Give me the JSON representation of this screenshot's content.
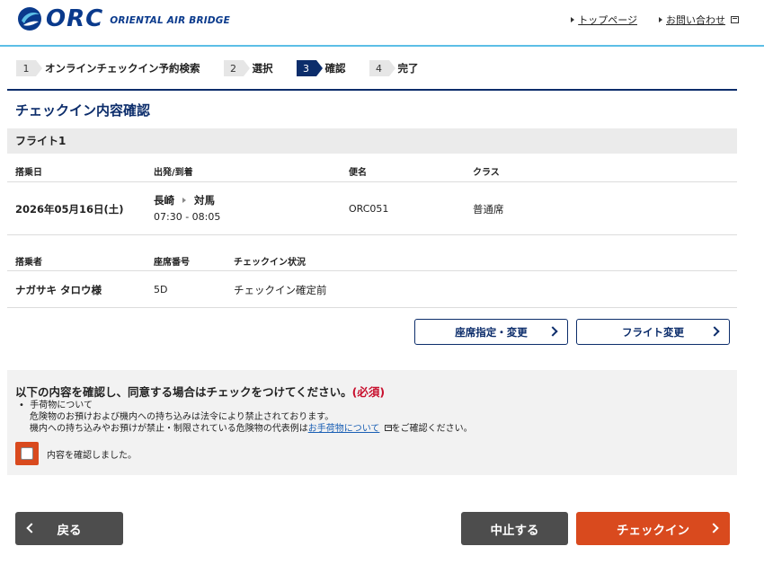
{
  "header": {
    "brand": "ORC",
    "brand_sub": "ORIENTAL AIR BRIDGE",
    "links": [
      "トップページ",
      "お問い合わせ"
    ]
  },
  "steps": [
    {
      "num": "1",
      "label": "オンラインチェックイン予約検索"
    },
    {
      "num": "2",
      "label": "選択"
    },
    {
      "num": "3",
      "label": "確認",
      "active": true
    },
    {
      "num": "4",
      "label": "完了"
    }
  ],
  "page_title": "チェックイン内容確認",
  "flight": {
    "heading": "フライト1",
    "headers": {
      "date": "搭乗日",
      "route": "出発/到着",
      "flight_no": "便名",
      "class": "クラス"
    },
    "date": "2026年05月16日(土)",
    "from": "長崎",
    "to": "対馬",
    "time": "07:30 - 08:05",
    "flight_no": "ORC051",
    "class": "普通席"
  },
  "passenger": {
    "headers": {
      "name": "搭乗者",
      "seat": "座席番号",
      "status": "チェックイン状況"
    },
    "name": "ナガサキ タロウ様",
    "seat": "5D",
    "status": "チェックイン確定前"
  },
  "actions": {
    "seat_change": "座席指定・変更",
    "flight_change": "フライト変更"
  },
  "consent": {
    "title": "以下の内容を確認し、同意する場合はチェックをつけてください。",
    "required": "(必須)",
    "bullet": "手荷物について",
    "line1": "危険物のお預けおよび機内への持ち込みは法令により禁止されております。",
    "line2_pre": "機内への持ち込みやお預けが禁止・制限されている危険物の代表例は",
    "line2_link": "お手荷物について",
    "line2_post": "をご確認ください。",
    "checkbox_label": "内容を確認しました。"
  },
  "buttons": {
    "back": "戻る",
    "cancel": "中止する",
    "checkin": "チェックイン"
  },
  "colors": {
    "navy": "#0c2d6b",
    "orange": "#d94a1e",
    "accent_line": "#5cbfe6",
    "gray_button": "#4d4d4d"
  }
}
